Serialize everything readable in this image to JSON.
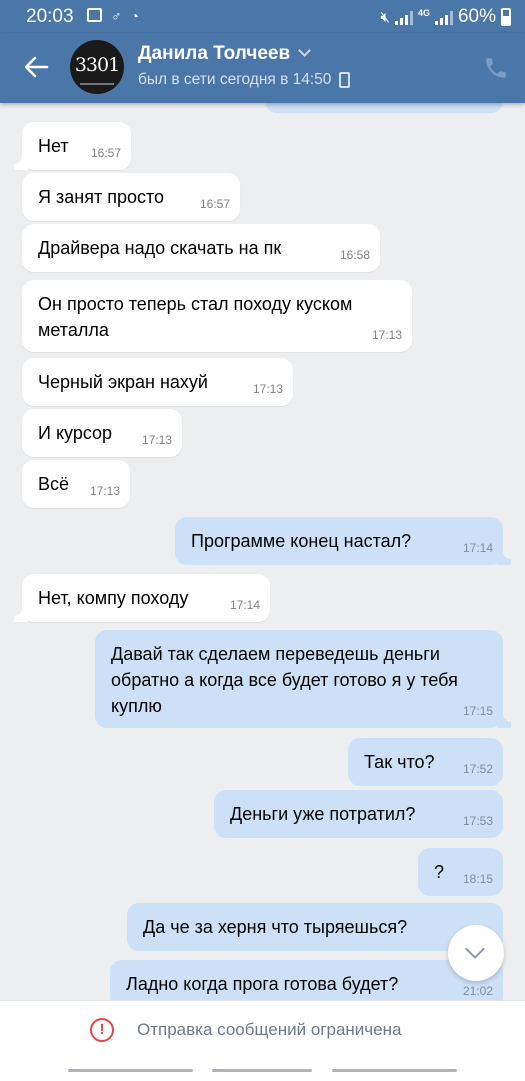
{
  "status_bar": {
    "time": "20:03",
    "network": "4G",
    "battery": "60%"
  },
  "header": {
    "avatar_text": "3301",
    "name": "Данила Толчеев",
    "presence": "был в сети сегодня в 14:50"
  },
  "messages": [
    {
      "dir": "in",
      "text": "Нет",
      "time": "16:57"
    },
    {
      "dir": "in",
      "text": "Я занят просто",
      "time": "16:57"
    },
    {
      "dir": "in",
      "text": "Драйвера надо скачать на пк",
      "time": "16:58"
    },
    {
      "dir": "in",
      "text": "Он просто теперь стал походу куском металла",
      "time": "17:13"
    },
    {
      "dir": "in",
      "text": "Черный экран нахуй",
      "time": "17:13"
    },
    {
      "dir": "in",
      "text": "И курсор",
      "time": "17:13"
    },
    {
      "dir": "in",
      "text": "Всё",
      "time": "17:13"
    },
    {
      "dir": "out",
      "text": "Программе конец настал?",
      "time": "17:14"
    },
    {
      "dir": "in",
      "text": "Нет, компу походу",
      "time": "17:14"
    },
    {
      "dir": "out",
      "text": "Давай так сделаем переведешь деньги обратно а когда все будет готово я у тебя куплю",
      "time": "17:15"
    },
    {
      "dir": "out",
      "text": "Так что?",
      "time": "17:52"
    },
    {
      "dir": "out",
      "text": "Деньги уже потратил?",
      "time": "17:53"
    },
    {
      "dir": "out",
      "text": "?",
      "time": "18:15"
    },
    {
      "dir": "out",
      "text": "Да че за херня что тыряешься?",
      "time": ""
    },
    {
      "dir": "out",
      "text": "Ладно когда прога готова будет?",
      "time": "21:02"
    }
  ],
  "footer": {
    "notice": "Отправка сообщений ограничена"
  },
  "colors": {
    "header_bg": "#4a76a8",
    "chat_bg": "#edeef0",
    "incoming_bubble": "#ffffff",
    "outgoing_bubble": "#cce0f7",
    "warning": "#e64646"
  }
}
